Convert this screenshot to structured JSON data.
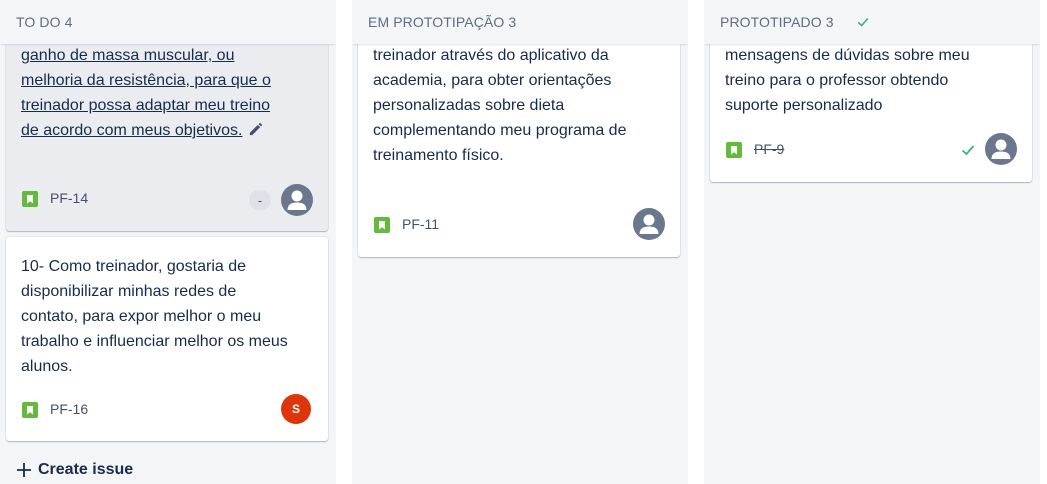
{
  "columns": [
    {
      "title": "TO DO",
      "count": "4",
      "cards": [
        {
          "text": "ganho de massa muscular, ou melhoria da resistência, para que o treinador possa adaptar meu treino de acordo com meus objetivos.",
          "key": "PF-14",
          "estimate": "-",
          "assignee_icon": "default-avatar-icon"
        },
        {
          "text": "10- Como treinador, gostaria de disponibilizar minhas redes de contato, para expor melhor o meu trabalho e influenciar melhor os meus alunos.",
          "key": "PF-16",
          "assignee_initial": "S"
        }
      ],
      "create_label": "Create issue"
    },
    {
      "title": "EM PROTOTIPAÇÃO",
      "count": "3",
      "cards": [
        {
          "text": "treinador através do aplicativo da academia, para obter orientações personalizadas sobre dieta complementando meu programa de treinamento físico.",
          "key": "PF-11",
          "assignee_icon": "default-avatar-icon"
        }
      ]
    },
    {
      "title": "PROTOTIPADO",
      "count": "3",
      "header_icon": "check-icon",
      "cards": [
        {
          "text": "mensagens de dúvidas sobre meu treino para o professor obtendo suporte personalizado",
          "key": "PF-9",
          "status_icon": "check-icon",
          "assignee_icon": "default-avatar-icon"
        }
      ]
    }
  ],
  "colors": {
    "column_bg": "#f4f5f7",
    "story_green": "#63ba3c",
    "done_green": "#36b37e",
    "avatar_red": "#de350b",
    "avatar_gray": "#6b778c"
  }
}
